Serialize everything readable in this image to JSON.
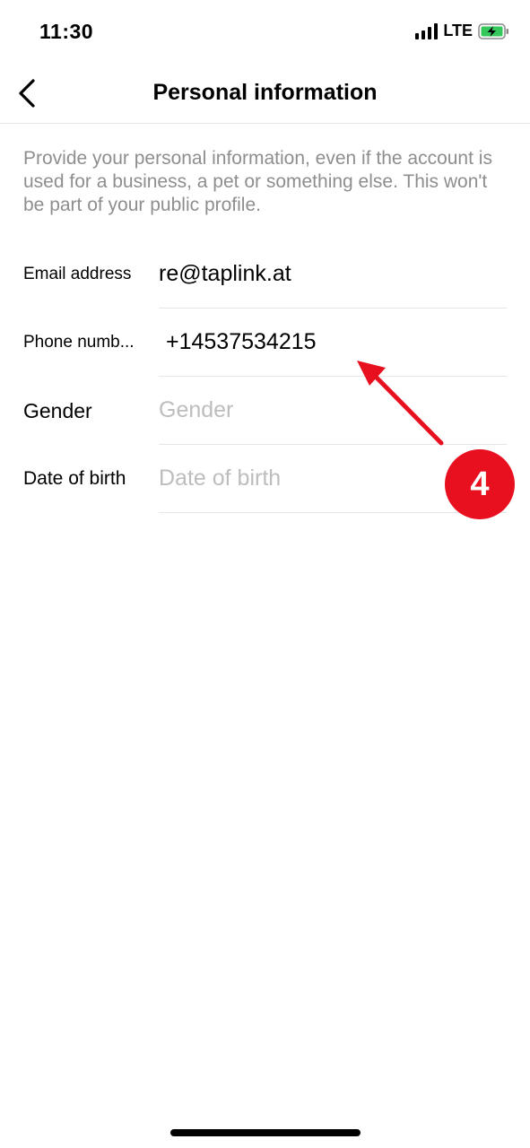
{
  "status_bar": {
    "time": "11:30",
    "network": "LTE",
    "signal_icon": "signal-bars-icon",
    "battery_icon": "battery-charging-icon"
  },
  "nav": {
    "back_icon": "chevron-left-icon",
    "title": "Personal information"
  },
  "description": "Provide your personal information, even if the account is used for a business, a pet or something else. This won't be part of your public profile.",
  "form": {
    "email": {
      "label": "Email address",
      "value": "re@taplink.at"
    },
    "phone": {
      "label": "Phone numb...",
      "value": "+14537534215"
    },
    "gender": {
      "label": "Gender",
      "placeholder": "Gender"
    },
    "dob": {
      "label": "Date of birth",
      "placeholder": "Date of birth"
    }
  },
  "annotation": {
    "step_number": "4",
    "color": "#e8101f"
  },
  "colors": {
    "text": "#000000",
    "secondary_text": "#8e8e8e",
    "placeholder": "#bdbdbd",
    "divider": "#e6e6e6",
    "battery_green": "#34c759"
  }
}
